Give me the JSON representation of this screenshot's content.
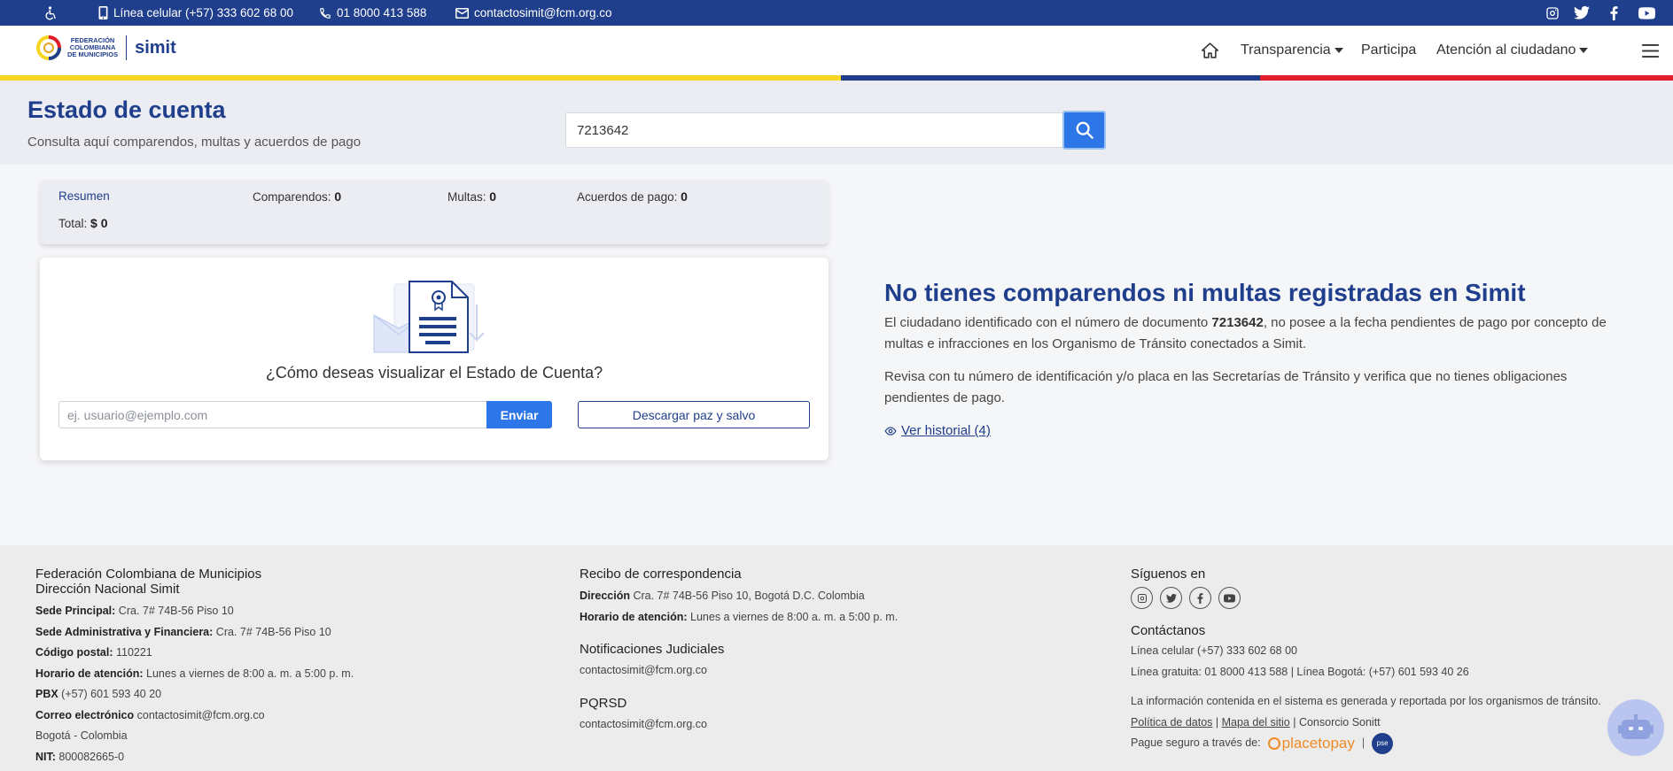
{
  "topbar": {
    "cell": "Línea celular (+57) 333 602 68 00",
    "phone": "01 8000 413 588",
    "email": "contactosimit@fcm.org.co"
  },
  "header": {
    "logo_line1": "FEDERACIÓN",
    "logo_line2": "COLOMBIANA",
    "logo_line3": "DE MUNICIPIOS",
    "logo_simit": "simit",
    "nav": {
      "transparencia": "Transparencia",
      "participa": "Participa",
      "atencion": "Atención al ciudadano"
    }
  },
  "colors": {
    "brand": "#1f3e8c",
    "accent": "#2c76e8",
    "yellow": "#f6d523",
    "red": "#e11d2d"
  },
  "hero": {
    "title": "Estado de cuenta",
    "subtitle": "Consulta aquí comparendos, multas y acuerdos de pago",
    "search_value": "7213642"
  },
  "summary": {
    "resumen": "Resumen",
    "comparendos_label": "Comparendos:",
    "comparendos_value": "0",
    "multas_label": "Multas:",
    "multas_value": "0",
    "acuerdos_label": "Acuerdos de pago:",
    "acuerdos_value": "0",
    "total_label": "Total:",
    "total_value": "$ 0"
  },
  "card": {
    "question": "¿Cómo deseas visualizar el Estado de Cuenta?",
    "email_placeholder": "ej. usuario@ejemplo.com",
    "send_label": "Enviar",
    "download_label": "Descargar paz y salvo"
  },
  "message": {
    "title": "No tienes comparendos ni multas registradas en Simit",
    "p1_a": "El ciudadano identificado con el número de documento ",
    "p1_doc": "7213642",
    "p1_b": ", no posee a la fecha pendientes de pago por concepto de multas e infracciones en los Organismo de Tránsito conectados a Simit.",
    "p2": "Revisa con tu número de identificación y/o placa en las Secretarías de Tránsito y verifica que no tienes obligaciones pendientes de pago.",
    "historial": "Ver historial (4)"
  },
  "footer": {
    "col1": {
      "title1": "Federación Colombiana de Municipios",
      "title2": "Dirección Nacional Simit",
      "sede_label": "Sede Principal:",
      "sede_value": " Cra. 7# 74B-56 Piso 10",
      "admin_label": "Sede Administrativa y Financiera:",
      "admin_value": " Cra. 7# 74B-56 Piso 10",
      "postal_label": "Código postal:",
      "postal_value": " 110221",
      "horario_label": "Horario de atención:",
      "horario_value": " Lunes a viernes de 8:00 a. m. a 5:00 p. m.",
      "pbx_label": "PBX",
      "pbx_value": " (+57) 601 593 40 20",
      "correo_label": "Correo electrónico",
      "correo_value": " contactosimit@fcm.org.co",
      "city": "Bogotá - Colombia",
      "nit_label": "NIT:",
      "nit_value": " 800082665-0"
    },
    "col2": {
      "title": "Recibo de correspondencia",
      "dir_label": "Dirección",
      "dir_value": " Cra. 7# 74B-56 Piso 10, Bogotá D.C. Colombia",
      "horario_label": "Horario de atención:",
      "horario_value": " Lunes a viernes de 8:00 a. m. a 5:00 p. m.",
      "notif_title": "Notificaciones Judiciales",
      "notif_email": "contactosimit@fcm.org.co",
      "pqrsd_title": "PQRSD",
      "pqrsd_email": "contactosimit@fcm.org.co"
    },
    "col3": {
      "siguenos": "Síguenos en",
      "contactanos": "Contáctanos",
      "cell": "Línea celular (+57) 333 602 68 00",
      "lines": "Línea gratuita: 01 8000 413 588 | Línea Bogotá: (+57) 601 593 40 26",
      "info": "La información contenida en el sistema es generada y reportada por los organismos de tránsito.",
      "politica": "Política de datos",
      "sep1": " | ",
      "mapa": "Mapa del sitio",
      "consorcio": " | Consorcio Sonitt",
      "paga": "Pague seguro a través de:",
      "placetopay": "placetopay",
      "pse": "pse"
    }
  }
}
